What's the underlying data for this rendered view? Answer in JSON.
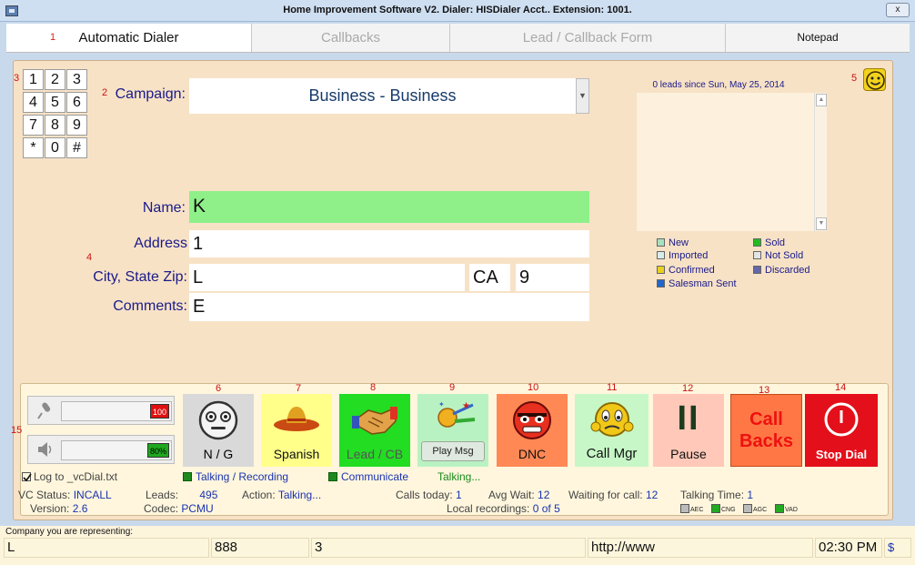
{
  "window": {
    "title": "Home Improvement Software V2. Dialer: HISDialer Acct.. Extension: 1001.",
    "close_label": "x"
  },
  "tabs": [
    {
      "num": "1",
      "label": "Automatic Dialer"
    },
    {
      "label": "Callbacks"
    },
    {
      "label": "Lead / Callback Form"
    },
    {
      "label": "Notepad"
    }
  ],
  "markers": {
    "m2": "2",
    "m3": "3",
    "m4": "4",
    "m5": "5",
    "m6": "6",
    "m7": "7",
    "m8": "8",
    "m9": "9",
    "m10": "10",
    "m11": "11",
    "m12": "12",
    "m13": "13",
    "m14": "14",
    "m15": "15"
  },
  "keypad": [
    "1",
    "2",
    "3",
    "4",
    "5",
    "6",
    "7",
    "8",
    "9",
    "*",
    "0",
    "#"
  ],
  "form": {
    "campaign_label": "Campaign:",
    "campaign_value": "Business - Business",
    "name_label": "Name:",
    "name_value": "K",
    "address_label": "Address",
    "address_value": "1",
    "city_label": "City, State Zip:",
    "city_value": "L",
    "state_value": "CA",
    "zip_value": "9",
    "comments_label": "Comments:",
    "comments_value": "E"
  },
  "leads": {
    "since": "0 leads since Sun, May 25, 2014",
    "legend": [
      {
        "label": "New",
        "color": "#a8e0c0"
      },
      {
        "label": "Sold",
        "color": "#22bb22"
      },
      {
        "label": "Imported",
        "color": "#d8ecec"
      },
      {
        "label": "Not Sold",
        "color": "#e4e4e4"
      },
      {
        "label": "Confirmed",
        "color": "#e8d020"
      },
      {
        "label": "Discarded",
        "color": "#6666aa"
      },
      {
        "label": "Salesman Sent",
        "color": "#2266cc"
      }
    ]
  },
  "volume": {
    "mic_level": "100",
    "speaker_level": "80%"
  },
  "actions": {
    "ng": "N / G",
    "spanish": "Spanish",
    "lead_cb": "Lead / CB",
    "play_msg": "Play Msg",
    "dnc": "DNC",
    "call_mgr": "Call Mgr",
    "pause_symbol": "II",
    "pause": "Pause",
    "callbacks_line1": "Call",
    "callbacks_line2": "Backs",
    "stop_dial": "Stop Dial"
  },
  "status": {
    "log_label": "Log to _vcDial.txt",
    "talking_recording": "Talking / Recording",
    "communicate": "Communicate",
    "talking": "Talking...",
    "vc_status_label": "VC Status:",
    "vc_status_value": "INCALL",
    "leads_label": "Leads:",
    "leads_value": "495",
    "action_label": "Action:",
    "action_value": "Talking...",
    "calls_today_label": "Calls today:",
    "calls_today_value": "1",
    "avg_wait_label": "Avg Wait:",
    "avg_wait_value": "12",
    "waiting_label": "Waiting for call:",
    "waiting_value": "12",
    "talking_time_label": "Talking Time:",
    "talking_time_value": "1",
    "version_label": "Version:",
    "version_value": "2.6",
    "codec_label": "Codec:",
    "codec_value": "PCMU",
    "local_rec_label": "Local recordings:",
    "local_rec_value": "0 of 5",
    "flags": [
      "AEC",
      "CNG",
      "AGC",
      "VAD"
    ]
  },
  "footer": {
    "company_label": "Company you are representing:",
    "company": "L",
    "phone": "888",
    "field3": "3",
    "url": "http://www",
    "time": "02:30 PM",
    "dollar": "$"
  }
}
